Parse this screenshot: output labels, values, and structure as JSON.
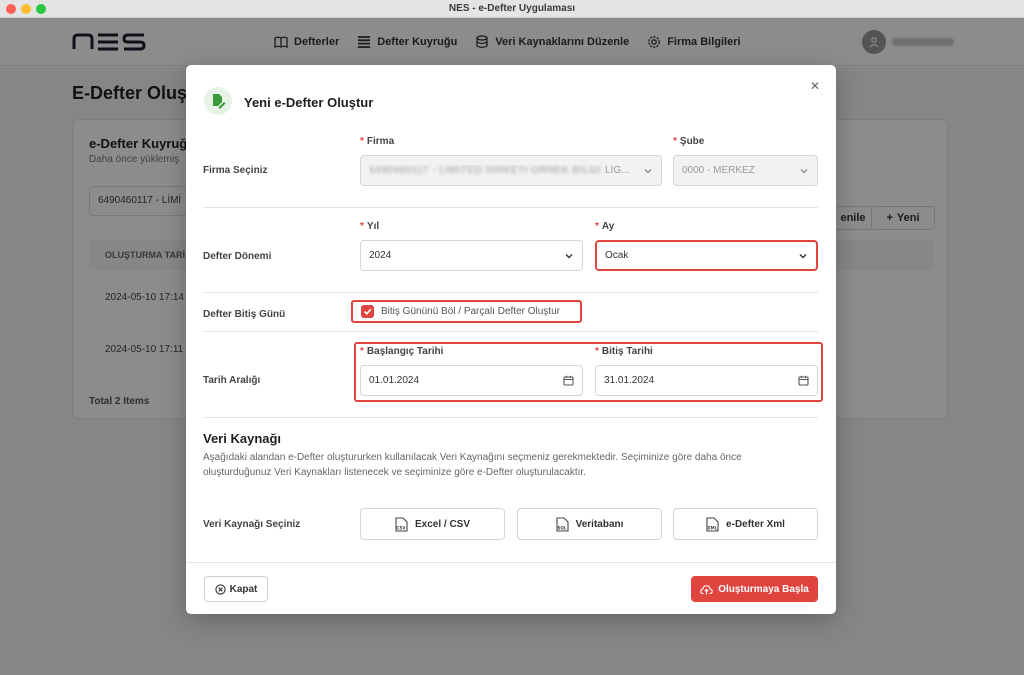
{
  "window": {
    "title": "NES - e-Defter Uygulaması"
  },
  "nav": [
    {
      "label": "Defterler",
      "icon": "book-icon"
    },
    {
      "label": "Defter Kuyruğu",
      "icon": "list-icon"
    },
    {
      "label": "Veri Kaynaklarını Düzenle",
      "icon": "database-icon"
    },
    {
      "label": "Firma Bilgileri",
      "icon": "gear-icon"
    }
  ],
  "page": {
    "title": "E-Defter Oluş",
    "card_title": "e-Defter Kuyruğ",
    "card_sub": "Daha önce yüklemiş",
    "filter_value": "6490460117 - LİMİ",
    "col_header": "OLUŞTURMA TARİ",
    "rows": [
      "2024-05-10 17:14",
      "2024-05-10 17:11"
    ],
    "total": "Total 2 Items",
    "btn_partial": "enile",
    "btn_new": "Yeni"
  },
  "modal": {
    "title": "Yeni e-Defter Oluştur",
    "firma_row_label": "Firma Seçiniz",
    "firma_label": "Firma",
    "firma_value": "6490460117 - LIMITED SIRKETI ORNEK BILGI TEKNOLOJILERI TIC.",
    "firma_value_suffix": "LİĞ...",
    "sube_label": "Şube",
    "sube_value": "0000 - MERKEZ",
    "donem_row_label": "Defter Dönemi",
    "yil_label": "Yıl",
    "yil_value": "2024",
    "ay_label": "Ay",
    "ay_value": "Ocak",
    "bitis_row_label": "Defter Bitiş Günü",
    "bitis_checkbox_label": "Bitiş Gününü Böl / Parçalı Defter Oluştur",
    "bitis_checked": true,
    "tarih_row_label": "Tarih Aralığı",
    "baslangic_label": "Başlangıç Tarihi",
    "baslangic_value": "01.01.2024",
    "bitis_tarihi_label": "Bitiş Tarihi",
    "bitis_tarihi_value": "31.01.2024",
    "veri_title": "Veri Kaynağı",
    "veri_desc": "Aşağıdaki alandan e-Defter oluştururken kullanılacak Veri Kaynağını seçmeniz gerekmektedir. Seçiminize göre daha önce oluşturduğunuz Veri Kaynakları listenecek ve seçiminize göre e-Defter oluşturulacaktır.",
    "veri_row_label": "Veri Kaynağı Seçiniz",
    "sources": [
      {
        "label": "Excel / CSV",
        "icon_text": "CSV"
      },
      {
        "label": "Veritabanı",
        "icon_text": "SQL"
      },
      {
        "label": "e-Defter Xml",
        "icon_text": "XML"
      }
    ],
    "close_label": "Kapat",
    "start_label": "Oluşturmaya Başla"
  },
  "colors": {
    "accent": "#e0443e",
    "icon_green": "#3a9a3a",
    "overlay": "#000000"
  }
}
